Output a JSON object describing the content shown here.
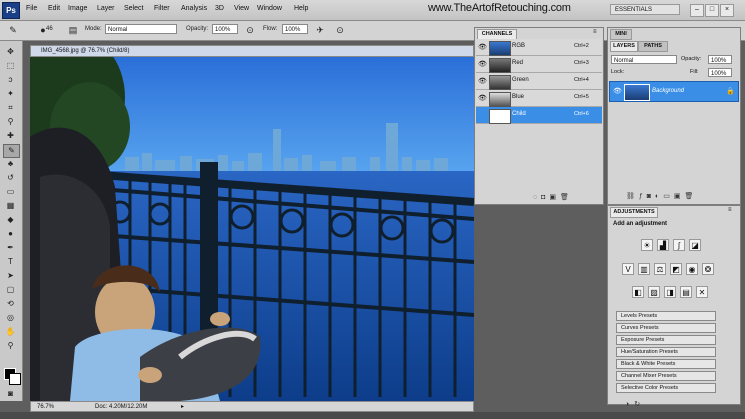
{
  "app": {
    "logo": "Ps",
    "menus": [
      "File",
      "Edit",
      "Image",
      "Layer",
      "Select",
      "Filter",
      "Analysis",
      "3D",
      "View",
      "Window",
      "Help"
    ],
    "watermark": "www.TheArtofRetouching.com",
    "workspace_label": "ESSENTIALS"
  },
  "options_bar": {
    "mode_label": "Mode:",
    "mode_value": "Normal",
    "opacity_label": "Opacity:",
    "opacity_value": "100%",
    "flow_label": "Flow:",
    "flow_value": "100%",
    "brush_size": "46"
  },
  "document": {
    "tab_title": "IMG_4568.jpg @ 76.7% (Child/8)",
    "zoom": "76.7%",
    "doc_info": "Doc: 4.20M/12.20M"
  },
  "channels_panel": {
    "tabs": [
      "CHANNELS"
    ],
    "rows": [
      {
        "name": "RGB",
        "shortcut": "Ctrl+2",
        "selected": false
      },
      {
        "name": "Red",
        "shortcut": "Ctrl+3",
        "selected": false
      },
      {
        "name": "Green",
        "shortcut": "Ctrl+4",
        "selected": false
      },
      {
        "name": "Blue",
        "shortcut": "Ctrl+5",
        "selected": false
      },
      {
        "name": "Child",
        "shortcut": "Ctrl+6",
        "selected": true
      }
    ]
  },
  "layers_panel": {
    "top_tab": "MINI",
    "tabs": [
      "LAYERS",
      "PATHS"
    ],
    "blend_mode": "Normal",
    "opacity_label": "Opacity:",
    "opacity_value": "100%",
    "lock_label": "Lock:",
    "fill_label": "Fill:",
    "fill_value": "100%",
    "layer_name": "Background"
  },
  "adjustments_panel": {
    "tab": "ADJUSTMENTS",
    "heading": "Add an adjustment",
    "presets": [
      "Levels Presets",
      "Curves Presets",
      "Exposure Presets",
      "Hue/Saturation Presets",
      "Black & White Presets",
      "Channel Mixer Presets",
      "Selective Color Presets"
    ]
  },
  "colors": {
    "accent": "#3a8ee6",
    "sky": "#2f7fe0",
    "water": "#1f5fb8"
  }
}
